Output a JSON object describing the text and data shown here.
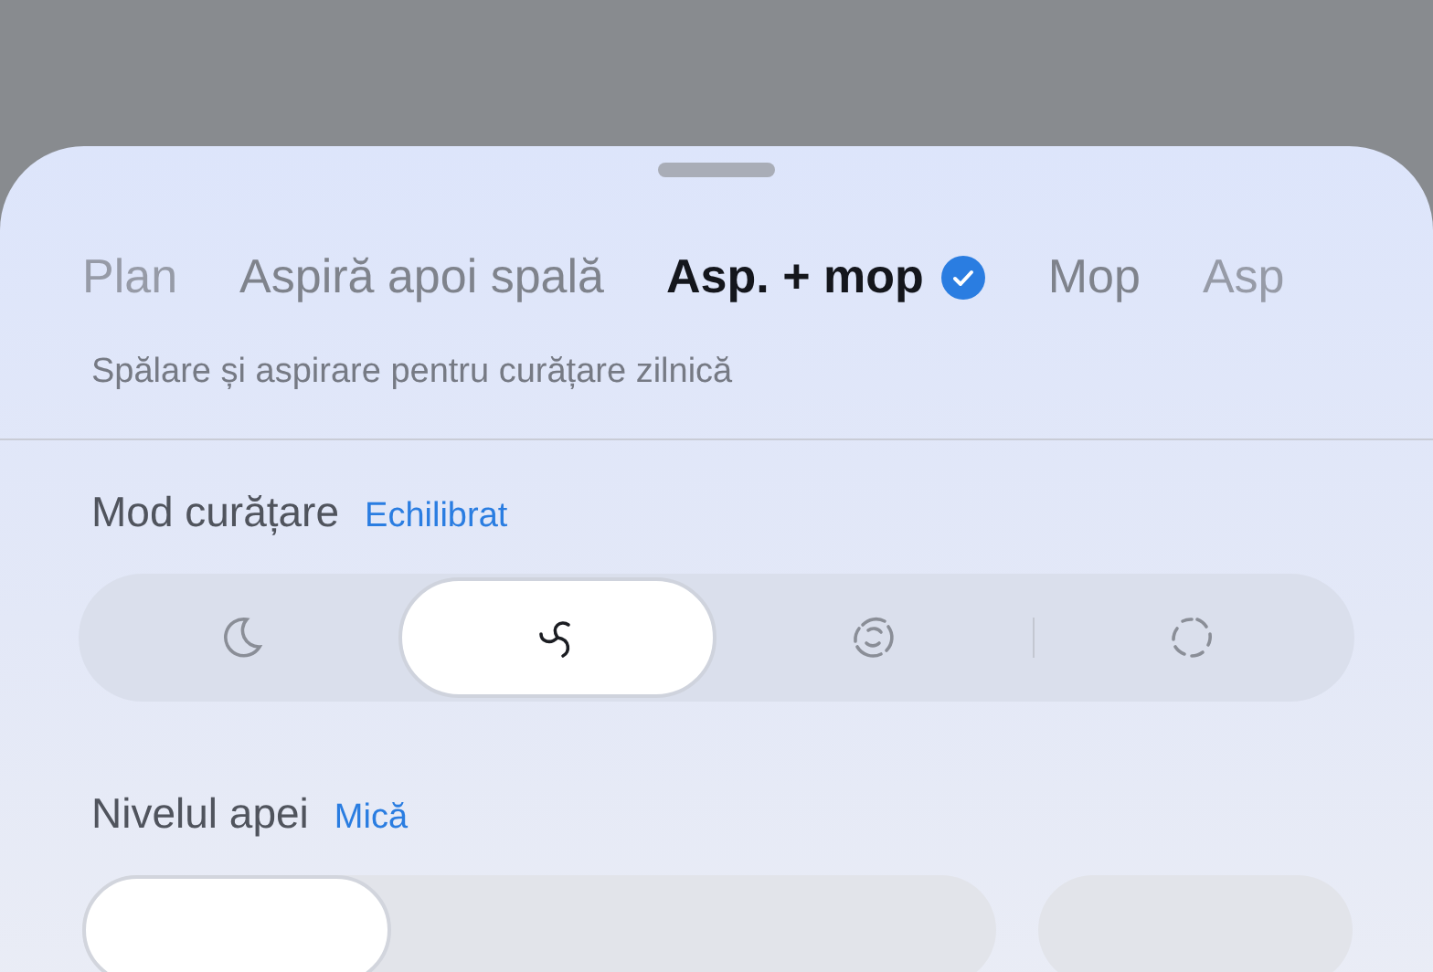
{
  "tabs": [
    {
      "label": "Plan",
      "selected": false
    },
    {
      "label": "Aspiră apoi spală",
      "selected": false
    },
    {
      "label": "Asp. + mop",
      "selected": true
    },
    {
      "label": "Mop",
      "selected": false
    },
    {
      "label": "Asp",
      "selected": false
    }
  ],
  "description": "Spălare și aspirare pentru curățare zilnică",
  "cleaning_mode": {
    "label": "Mod curățare",
    "value": "Echilibrat",
    "options": [
      {
        "kind": "moon",
        "selected": false
      },
      {
        "kind": "swirl",
        "selected": true
      },
      {
        "kind": "ring",
        "selected": false
      },
      {
        "kind": "dashed",
        "selected": false
      }
    ]
  },
  "water_level": {
    "label": "Nivelul apei",
    "value": "Mică",
    "options": [
      {
        "selected": true
      },
      {
        "selected": false
      },
      {
        "selected": false
      },
      {
        "selected": false
      }
    ]
  }
}
